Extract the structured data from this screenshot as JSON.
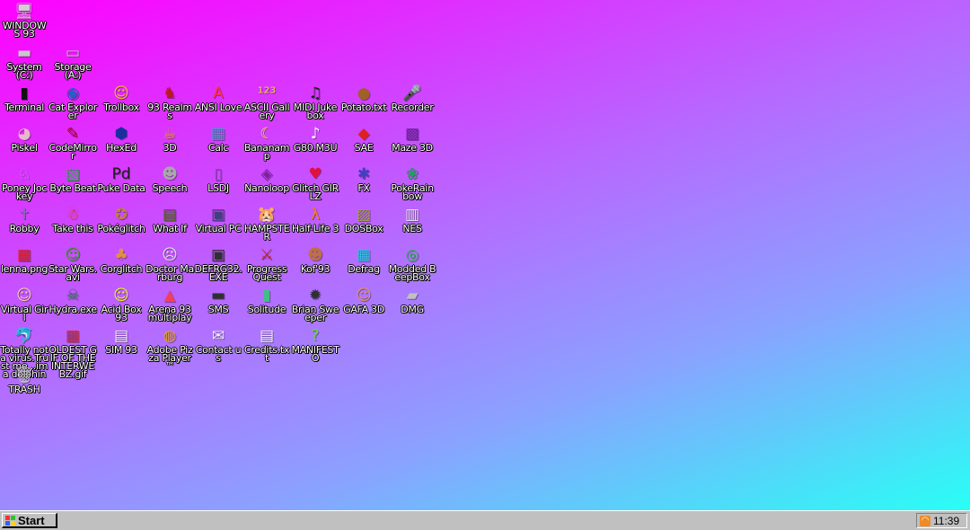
{
  "desktop": {
    "background": {
      "from": "#ff00ff",
      "to": "#28fff5"
    },
    "icons": [
      {
        "label": "WINDOWS 93",
        "glyph": "🖥",
        "color": "#d0d0d0",
        "name": "windows93-icon"
      },
      {
        "label": "System (C:)",
        "glyph": "▬",
        "color": "#c8c8c8",
        "name": "system-drive-icon"
      },
      {
        "label": "Storage (A:)",
        "glyph": "▭",
        "color": "#c8c8c8",
        "name": "storage-drive-icon"
      },
      {
        "label": "Terminal",
        "glyph": "▮",
        "color": "#111111",
        "name": "terminal-icon"
      },
      {
        "label": "Cat Explorer",
        "glyph": "◉",
        "color": "#1f62c9",
        "name": "cat-explorer-icon"
      },
      {
        "label": "Trollbox",
        "glyph": "☺",
        "color": "#f0c020",
        "name": "trollbox-icon"
      },
      {
        "label": "93 Realms",
        "glyph": "♞",
        "color": "#c01818",
        "name": "93-realms-icon"
      },
      {
        "label": "ANSI Love",
        "glyph": "A",
        "color": "#ff3333",
        "name": "ansi-love-icon"
      },
      {
        "label": "ASCII Gallery",
        "glyph": "¹²³",
        "color": "#e8d040",
        "name": "ascii-gallery-icon"
      },
      {
        "label": "MIDI Jukebox",
        "glyph": "♫",
        "color": "#222222",
        "name": "midi-jukebox-icon"
      },
      {
        "label": "Potato.txt",
        "glyph": "●",
        "color": "#a0602a",
        "name": "potato-icon"
      },
      {
        "label": "Recorder",
        "glyph": "🎤",
        "color": "#333333",
        "name": "recorder-icon"
      },
      {
        "label": "Piskel",
        "glyph": "◕",
        "color": "#e6b8c8",
        "name": "piskel-icon"
      },
      {
        "label": "CodeMirror",
        "glyph": "✎",
        "color": "#b00020",
        "name": "codemirror-icon"
      },
      {
        "label": "HexEd",
        "glyph": "⬢",
        "color": "#1830a0",
        "name": "hexed-icon"
      },
      {
        "label": "3D",
        "glyph": "☕",
        "color": "#f0a020",
        "name": "3d-teapot-icon"
      },
      {
        "label": "Calc",
        "glyph": "▦",
        "color": "#20b0c0",
        "name": "calc-icon"
      },
      {
        "label": "Bananamp",
        "glyph": "☾",
        "color": "#f8e030",
        "name": "bananamp-icon"
      },
      {
        "label": "G80.M3U",
        "glyph": "♪",
        "color": "#ffffff",
        "name": "g80-playlist-icon"
      },
      {
        "label": "SAE",
        "glyph": "◆",
        "color": "#e02020",
        "name": "sae-icon"
      },
      {
        "label": "Maze 3D",
        "glyph": "▩",
        "color": "#7020a0",
        "name": "maze3d-icon"
      },
      {
        "label": "Poney Jockey",
        "glyph": "♘",
        "color": "#c080f0",
        "name": "poney-jockey-icon"
      },
      {
        "label": "Byte Beat",
        "glyph": "▧",
        "color": "#20c040",
        "name": "byte-beat-icon"
      },
      {
        "label": "Puke Data",
        "glyph": "Pd",
        "color": "#202020",
        "name": "puke-data-icon"
      },
      {
        "label": "Speech",
        "glyph": "☻",
        "color": "#a8a8a8",
        "name": "speech-icon"
      },
      {
        "label": "LSDJ",
        "glyph": "▯",
        "color": "#9040c0",
        "name": "lsdj-icon"
      },
      {
        "label": "Nanoloop",
        "glyph": "◈",
        "color": "#8020a0",
        "name": "nanoloop-icon"
      },
      {
        "label": "Glitch GIRLZ",
        "glyph": "♥",
        "color": "#e01040",
        "name": "glitch-girlz-icon"
      },
      {
        "label": "FX",
        "glyph": "✱",
        "color": "#4040c0",
        "name": "fx-icon"
      },
      {
        "label": "PokeRainbow",
        "glyph": "❀",
        "color": "#20a060",
        "name": "pokerainbow-icon"
      },
      {
        "label": "Robby",
        "glyph": "✝",
        "color": "#9060c0",
        "name": "robby-icon"
      },
      {
        "label": "Take this",
        "glyph": "☃",
        "color": "#ff4030",
        "name": "take-this-icon"
      },
      {
        "label": "Pokéglitch",
        "glyph": "✪",
        "color": "#c08040",
        "name": "pokeglitch-icon"
      },
      {
        "label": "What If",
        "glyph": "▤",
        "color": "#506020",
        "name": "what-if-icon"
      },
      {
        "label": "Virtual PC",
        "glyph": "▣",
        "color": "#404080",
        "name": "virtual-pc-icon"
      },
      {
        "label": "HAMPSTER",
        "glyph": "🐹",
        "color": "#e0e0e0",
        "name": "hampster-icon"
      },
      {
        "label": "Half-Life 3",
        "glyph": "λ",
        "color": "#f08020",
        "name": "half-life3-icon"
      },
      {
        "label": "DOSBox",
        "glyph": "▨",
        "color": "#a0a040",
        "name": "dosbox-icon"
      },
      {
        "label": "NES",
        "glyph": "▥",
        "color": "#e8e8e8",
        "name": "nes-icon"
      },
      {
        "label": "lenna.png",
        "glyph": "▦",
        "color": "#e02020",
        "name": "lenna-image-icon"
      },
      {
        "label": "Star Wars.avi",
        "glyph": "☺",
        "color": "#40a030",
        "name": "star-wars-video-icon"
      },
      {
        "label": "Corglitch",
        "glyph": "♣",
        "color": "#e09040",
        "name": "corglitch-icon"
      },
      {
        "label": "Doctor Marburg",
        "glyph": "☹",
        "color": "#e0e0e0",
        "name": "doctor-marburg-icon"
      },
      {
        "label": "DEFRG32.EXE",
        "glyph": "▣",
        "color": "#303030",
        "name": "defrg32-icon"
      },
      {
        "label": "Progress Quest",
        "glyph": "⚔",
        "color": "#c02020",
        "name": "progress-quest-icon"
      },
      {
        "label": "Kof'93",
        "glyph": "☻",
        "color": "#c07040",
        "name": "kof93-icon"
      },
      {
        "label": "Defrag",
        "glyph": "▦",
        "color": "#30c0e0",
        "name": "defrag-icon"
      },
      {
        "label": "Modded BeepBox",
        "glyph": "◎",
        "color": "#20c040",
        "name": "modded-beepbox-icon"
      },
      {
        "label": "Virtual Girl",
        "glyph": "☺",
        "color": "#f0c8b0",
        "name": "virtual-girl-icon"
      },
      {
        "label": "Hydra.exe",
        "glyph": "☠",
        "color": "#208040",
        "name": "hydra-exe-icon"
      },
      {
        "label": "Acid Box 93",
        "glyph": "☺",
        "color": "#e8f020",
        "name": "acid-box-icon"
      },
      {
        "label": "Arena 93 multiplay",
        "glyph": "▲",
        "color": "#f04060",
        "name": "arena93-icon"
      },
      {
        "label": "SMS",
        "glyph": "▬",
        "color": "#303030",
        "name": "sms-icon"
      },
      {
        "label": "Solitude",
        "glyph": "▮",
        "color": "#40c080",
        "name": "solitude-icon"
      },
      {
        "label": "Brian Sweeper",
        "glyph": "✹",
        "color": "#303030",
        "name": "brian-sweeper-icon"
      },
      {
        "label": "GAFA 3D",
        "glyph": "☺",
        "color": "#e09060",
        "name": "gafa3d-icon"
      },
      {
        "label": "DMG",
        "glyph": "▰",
        "color": "#c0c0c0",
        "name": "dmg-icon"
      },
      {
        "label": "Totally not a virus.Trust me...im a dolphin",
        "glyph": "🐬",
        "color": "#3080c0",
        "name": "dolphin-virus-icon"
      },
      {
        "label": "OLDEST GIF OF THE INTERWEBZ.gif",
        "glyph": "▦",
        "color": "#e02020",
        "name": "oldest-gif-icon"
      },
      {
        "label": "SIM 93",
        "glyph": "▤",
        "color": "#f0f0f0",
        "name": "sim93-icon"
      },
      {
        "label": "Adobe Pizza Player™",
        "glyph": "◍",
        "color": "#e0a030",
        "name": "adobe-pizza-player-icon"
      },
      {
        "label": "Contact us",
        "glyph": "✉",
        "color": "#f0f0f0",
        "name": "contact-us-icon"
      },
      {
        "label": "Credits.txt",
        "glyph": "▤",
        "color": "#f8f8f8",
        "name": "credits-txt-icon"
      },
      {
        "label": "MANIFESTO",
        "glyph": "?",
        "color": "#60e020",
        "name": "manifesto-icon"
      },
      {
        "label": "TRASH",
        "glyph": "🗑",
        "color": "#c0c0c0",
        "name": "trash-icon"
      }
    ]
  },
  "taskbar": {
    "start_label": "Start",
    "start_logo_colors": [
      "#ff3030",
      "#30c030",
      "#3060ff",
      "#ffd020"
    ],
    "tray_icon": "rss-icon",
    "clock": "11:39"
  }
}
